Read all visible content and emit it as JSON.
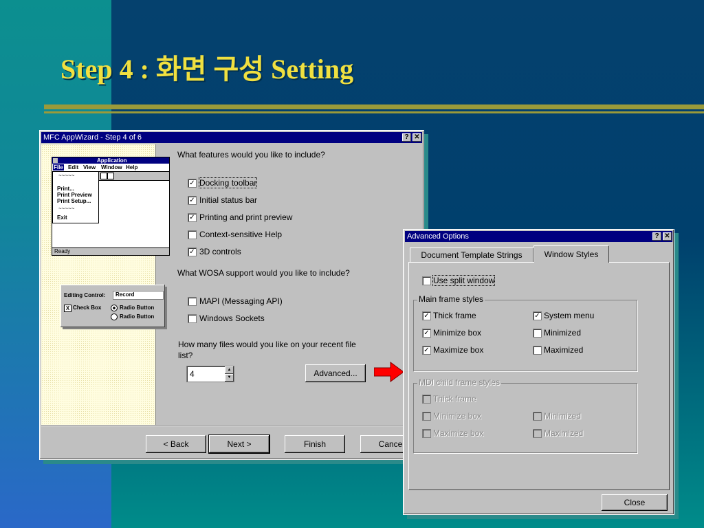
{
  "slide": {
    "title": "Step 4 : 화면 구성 Setting"
  },
  "wizard": {
    "title": "MFC AppWizard - Step 4 of 6",
    "help_btn": "?",
    "close_btn": "✕",
    "preview": {
      "app_title": "Application",
      "menu_file": "File",
      "menu_edit": "Edit",
      "menu_view": "View",
      "menu_window": "Window",
      "menu_help": "Help",
      "dd_sep1": "~~~~~",
      "dd_print": "Print...",
      "dd_preview": "Print Preview",
      "dd_setup": "Print Setup...",
      "dd_sep2": "~~~~~",
      "dd_exit": "Exit",
      "status": "Ready",
      "edit_label": "Editing Control:",
      "edit_value": "Record",
      "check_label": "Check Box",
      "radio1": "Radio Button",
      "radio2": "Radio Button",
      "check_mark": "X"
    },
    "q_features": "What features would you like to include?",
    "features": [
      {
        "label": "Docking toolbar",
        "mark": "✓"
      },
      {
        "label": "Initial status bar",
        "mark": "✓"
      },
      {
        "label": "Printing and print preview",
        "mark": "✓"
      },
      {
        "label": "Context-sensitive Help",
        "mark": ""
      },
      {
        "label": "3D controls",
        "mark": "✓"
      }
    ],
    "q_wosa": "What WOSA support would you like to include?",
    "wosa": [
      {
        "label": "MAPI (Messaging API)",
        "mark": ""
      },
      {
        "label": "Windows Sockets",
        "mark": ""
      }
    ],
    "q_files_1": "How many files would you like on your recent file",
    "q_files_2": "list?",
    "files_value": "4",
    "spin_up": "▲",
    "spin_down": "▼",
    "advanced_btn": "Advanced...",
    "back_btn": "< Back",
    "next_btn": "Next >",
    "finish_btn": "Finish",
    "cancel_btn": "Cance"
  },
  "advanced": {
    "title": "Advanced Options",
    "help_btn": "?",
    "close_x": "✕",
    "tab1": "Document Template Strings",
    "tab2": "Window Styles",
    "split": {
      "label": "Use split window",
      "mark": ""
    },
    "main_group": "Main frame styles",
    "main": [
      {
        "label": "Thick frame",
        "mark": "✓"
      },
      {
        "label": "System menu",
        "mark": "✓"
      },
      {
        "label": "Minimize box",
        "mark": "✓"
      },
      {
        "label": "Minimized",
        "mark": ""
      },
      {
        "label": "Maximize box",
        "mark": "✓"
      },
      {
        "label": "Maximized",
        "mark": ""
      }
    ],
    "mdi_group": "MDI child frame styles",
    "mdi": [
      {
        "label": "Thick frame"
      },
      {
        "label": "Minimize box"
      },
      {
        "label": "Minimized"
      },
      {
        "label": "Maximize box"
      },
      {
        "label": "Maximized"
      }
    ],
    "close_btn": "Close"
  }
}
